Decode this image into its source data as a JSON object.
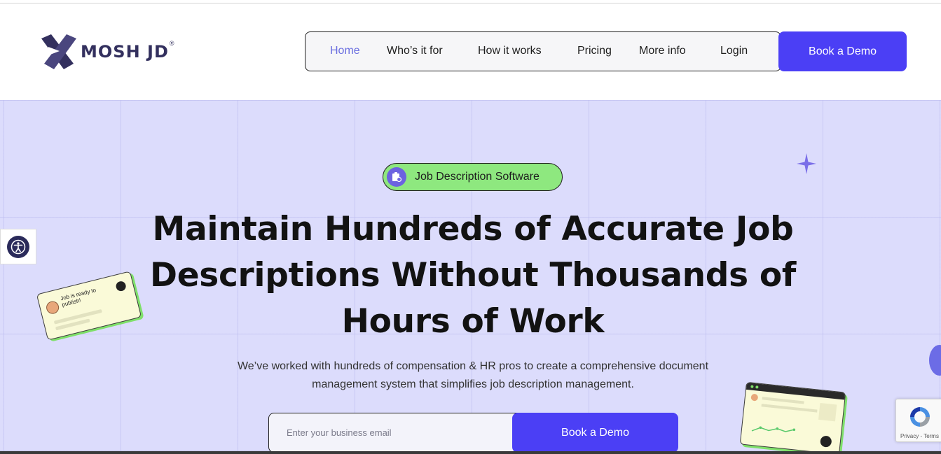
{
  "brand": {
    "name": "MOSH JD",
    "registered": "®"
  },
  "nav": {
    "items": [
      {
        "label": "Home",
        "active": true
      },
      {
        "label": "Who’s it for",
        "active": false
      },
      {
        "label": "How it works",
        "active": false
      },
      {
        "label": "Pricing",
        "active": false
      },
      {
        "label": "More info",
        "active": false
      },
      {
        "label": "Login",
        "active": false
      }
    ],
    "cta_label": "Book a Demo"
  },
  "hero": {
    "badge_label": "Job Description Software",
    "headline_lines": [
      "Maintain Hundreds of Accurate Job",
      "Descriptions Without Thousands of",
      "Hours of Work"
    ],
    "subtext_lines": [
      "We’ve worked with hundreds of compensation & HR pros to create a comprehensive document",
      "management system that simplifies job description management."
    ],
    "email_placeholder": "Enter your business email",
    "email_value": "",
    "cta_label": "Book a Demo",
    "card_left_text": "Job is ready to publish!"
  },
  "recaptcha": {
    "links": "Privacy - Terms"
  },
  "colors": {
    "accent": "#4b3ff5",
    "hero_bg": "#dcdcfc",
    "badge_bg": "#8ee87f",
    "logo": "#33305e",
    "nav_active": "#6a6ee0"
  },
  "icons": {
    "logo": "mosh-x-logo-icon",
    "badge": "document-settings-icon",
    "sparkle": "sparkle-icon",
    "accessibility": "accessibility-icon",
    "recaptcha": "recaptcha-icon"
  }
}
